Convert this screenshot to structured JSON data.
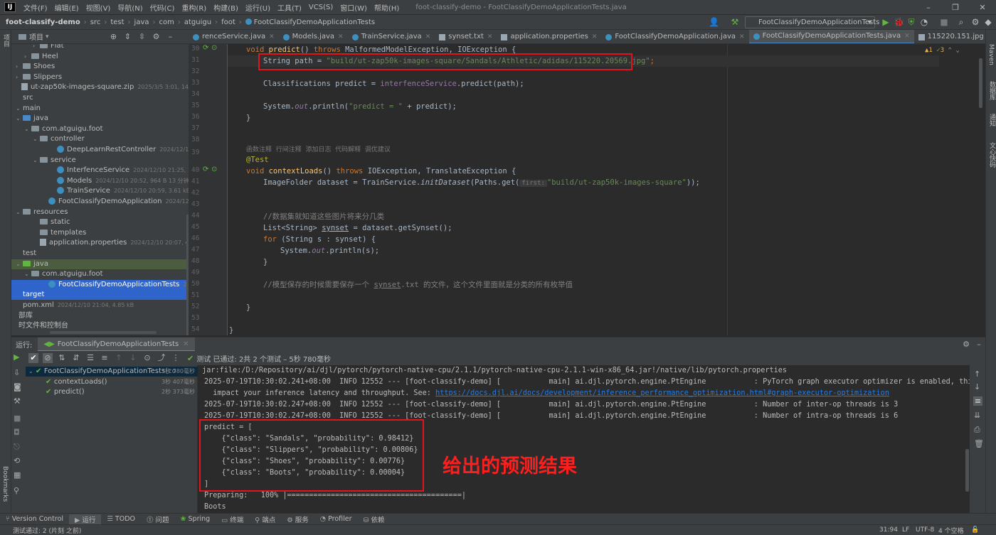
{
  "menu": {
    "items": [
      "文件(F)",
      "编辑(E)",
      "视图(V)",
      "导航(N)",
      "代码(C)",
      "重构(R)",
      "构建(B)",
      "运行(U)",
      "工具(T)",
      "VCS(S)",
      "窗口(W)",
      "帮助(H)"
    ],
    "window_title": "foot-classify-demo - FootClassifyDemoApplicationTests.java"
  },
  "breadcrumb": {
    "project": "foot-classify-demo",
    "parts": [
      "src",
      "test",
      "java",
      "com",
      "atguigu",
      "foot"
    ],
    "file": "FootClassifyDemoApplicationTests"
  },
  "run_config": "FootClassifyDemoApplicationTests",
  "project_panel": {
    "title": "项目",
    "tree": [
      {
        "label": "Flat",
        "meta": "",
        "indent": 30,
        "type": "folder",
        "arrow": "›"
      },
      {
        "label": "Heel",
        "meta": "",
        "indent": 18,
        "type": "folder",
        "arrow": "›"
      },
      {
        "label": "Shoes",
        "meta": "",
        "indent": 6,
        "type": "folder",
        "arrow": "›"
      },
      {
        "label": "Slippers",
        "meta": "",
        "indent": 6,
        "type": "folder",
        "arrow": "›"
      },
      {
        "label": "ut-zap50k-images-square.zip",
        "meta": "2025/3/5 3:01, 144.23 MB",
        "indent": 4,
        "type": "file",
        "arrow": ""
      },
      {
        "label": "src",
        "meta": "",
        "indent": 6,
        "type": "none",
        "arrow": ""
      },
      {
        "label": "main",
        "meta": "",
        "indent": 6,
        "type": "none",
        "arrow": "⌄"
      },
      {
        "label": "java",
        "meta": "",
        "indent": 6,
        "type": "blue",
        "arrow": "⌄"
      },
      {
        "label": "com.atguigu.foot",
        "meta": "",
        "indent": 18,
        "type": "folder",
        "arrow": "⌄"
      },
      {
        "label": "controller",
        "meta": "",
        "indent": 30,
        "type": "folder",
        "arrow": "⌄"
      },
      {
        "label": "DeepLearnRestController",
        "meta": "2024/12/10 21:02,",
        "indent": 54,
        "type": "class",
        "arrow": ""
      },
      {
        "label": "service",
        "meta": "",
        "indent": 30,
        "type": "folder",
        "arrow": "⌄"
      },
      {
        "label": "InterfenceService",
        "meta": "2024/12/10 21:25, 1.88 kB",
        "indent": 54,
        "type": "class",
        "arrow": ""
      },
      {
        "label": "Models",
        "meta": "2024/12/10 20:52, 964 B 13 分钟 之前",
        "indent": 54,
        "type": "class",
        "arrow": ""
      },
      {
        "label": "TrainService",
        "meta": "2024/12/10 20:59, 3.61 kB 22 分钟",
        "indent": 54,
        "type": "class",
        "arrow": ""
      },
      {
        "label": "FootClassifyDemoApplication",
        "meta": "2024/12/10 20:07,",
        "indent": 42,
        "type": "class",
        "arrow": ""
      },
      {
        "label": "resources",
        "meta": "",
        "indent": 6,
        "type": "folder",
        "arrow": "⌄"
      },
      {
        "label": "static",
        "meta": "",
        "indent": 30,
        "type": "folder",
        "arrow": ""
      },
      {
        "label": "templates",
        "meta": "",
        "indent": 30,
        "type": "folder",
        "arrow": ""
      },
      {
        "label": "application.properties",
        "meta": "2024/12/10 20:07, 43 B 26 分",
        "indent": 30,
        "type": "file",
        "arrow": ""
      },
      {
        "label": "test",
        "meta": "",
        "indent": 6,
        "type": "none",
        "arrow": ""
      },
      {
        "label": "java",
        "meta": "",
        "indent": 6,
        "type": "green",
        "arrow": "⌄",
        "selected": "green"
      },
      {
        "label": "com.atguigu.foot",
        "meta": "",
        "indent": 18,
        "type": "folder",
        "arrow": "⌄"
      },
      {
        "label": "FootClassifyDemoApplicationTests",
        "meta": "2025/7/19",
        "indent": 42,
        "type": "class",
        "arrow": "",
        "selected": "blue"
      },
      {
        "label": "target",
        "meta": "",
        "indent": 6,
        "type": "none",
        "arrow": "",
        "selected": "blue"
      },
      {
        "label": "pom.xml",
        "meta": "2024/12/10 21:04, 4.85 kB",
        "indent": 6,
        "type": "none",
        "arrow": ""
      },
      {
        "label": "部库",
        "meta": "",
        "indent": 0,
        "type": "none",
        "arrow": ""
      },
      {
        "label": "时文件和控制台",
        "meta": "",
        "indent": 0,
        "type": "none",
        "arrow": ""
      }
    ]
  },
  "tabs": [
    {
      "label": "renceService.java",
      "kind": "class",
      "active": false
    },
    {
      "label": "Models.java",
      "kind": "class",
      "active": false
    },
    {
      "label": "TrainService.java",
      "kind": "class",
      "active": false
    },
    {
      "label": "synset.txt",
      "kind": "file",
      "active": false
    },
    {
      "label": "application.properties",
      "kind": "file",
      "active": false
    },
    {
      "label": "FootClassifyDemoApplication.java",
      "kind": "class",
      "active": false
    },
    {
      "label": "FootClassifyDemoApplicationTests.java",
      "kind": "class",
      "active": true
    },
    {
      "label": "115220.151.jpg",
      "kind": "file",
      "active": false
    },
    {
      "label": "115220.20569.jpg",
      "kind": "file",
      "active": false
    }
  ],
  "editor": {
    "line_numbers": [
      "30",
      "31",
      "32",
      "33",
      "34",
      "35",
      "36",
      "37",
      "38",
      "39",
      "40",
      "41",
      "42",
      "43",
      "44",
      "45",
      "46",
      "47",
      "48",
      "49",
      "50",
      "51",
      "52",
      "53",
      "54"
    ],
    "inspections": {
      "warnings": "1",
      "weak": "3"
    },
    "code": {
      "l30_kw": "void ",
      "l30_fn": "predict",
      "l30_rest": "() ",
      "l30_kw2": "throws ",
      "l30_rest2": "MalformedModelException, IOException {",
      "l31_a": "String path = ",
      "l31_str": "\"build/ut-zap50k-images-square/Sandals/Athletic/adidas/115220.20569.jpg\"",
      "l31_b": ";",
      "l33_a": "Classifications predict = ",
      "l33_b": "interfenceService",
      ".l33_c": "",
      "l33_c": ".predict(path);",
      "l35_a": "System.",
      "l35_st": "out",
      "l35_b": ".println(",
      "l35_str": "\"predict = \"",
      "l35_c": " + predict);",
      "l36": "}",
      "l38_hint": "函数注释  行间注释  添加日志  代码解释  调优建议",
      "l39": "@Test",
      "l40_kw": "void ",
      "l40_fn": "contextLoads",
      "l40_rest": "() ",
      "l40_kw2": "throws ",
      "l40_rest2": "IOException, TranslateException {",
      "l41_a": "ImageFolder dataset = TrainService.",
      "l41_it": "initDataset",
      "l41_b": "(Paths.get(",
      "l41_hint": "first:",
      "l41_str": "\"build/ut-zap50k-images-square\"",
      "l41_c": "));",
      "l44": "//数据集就知道这些图片将来分几类",
      "l45_a": "List<String> ",
      "l45_u": "synset",
      "l45_b": " = dataset.getSynset();",
      "l46_kw": "for ",
      "l46_b": "(String s : synset) {",
      "l47_a": "System.",
      "l47_st": "out",
      "l47_b": ".println(s);",
      "l48": "}",
      "l50_a": "//模型保存的时候需要保存一个 ",
      "l50_u": "synset",
      "l50_b": ".txt 的文件，这个文件里面就是分类的所有枚举值",
      "l52": "}",
      "l54": "}"
    }
  },
  "run_panel": {
    "label": "运行:",
    "tab": "FootClassifyDemoApplicationTests",
    "status": "测试 已通过: 2共 2 个测试 – 5秒 780毫秒",
    "tree": [
      {
        "label": "FootClassifyDemoApplicationTests",
        "extra": "(co",
        "time": "5秒 780毫秒"
      },
      {
        "label": "contextLoads()",
        "extra": "",
        "time": "3秒 407毫秒"
      },
      {
        "label": "predict()",
        "extra": "",
        "time": "2秒 373毫秒"
      }
    ]
  },
  "console": {
    "lines": [
      " jar:file:/D:/Repository/ai/djl/pytorch/pytorch-native-cpu/2.1.1/pytorch-native-cpu-2.1.1-win-x86_64.jar!/native/lib/pytorch.properties",
      "2025-07-19T10:30:02.241+08:00  INFO 12552 --- [foot-classify-demo] [           main] ai.djl.pytorch.engine.PtEngine           : PyTorch graph executor optimizer is enabled, this may",
      "  impact your inference latency and throughput. See: ",
      "2025-07-19T10:30:02.247+08:00  INFO 12552 --- [foot-classify-demo] [           main] ai.djl.pytorch.engine.PtEngine           : Number of inter-op threads is 3",
      "2025-07-19T10:30:02.247+08:00  INFO 12552 --- [foot-classify-demo] [           main] ai.djl.pytorch.engine.PtEngine           : Number of intra-op threads is 6",
      "predict = [",
      "    {\"class\": \"Sandals\", \"probability\": 0.98412}",
      "    {\"class\": \"Slippers\", \"probability\": 0.00806}",
      "    {\"class\": \"Shoes\", \"probability\": 0.00776}",
      "    {\"class\": \"Boots\", \"probability\": 0.00004}",
      "]",
      "Preparing:   100% |========================================|",
      "Boots"
    ],
    "link": "https://docs.djl.ai/docs/development/inference_performance_optimization.html#graph-executor-optimization"
  },
  "annotation": "给出的预测结果",
  "bottom_tools": [
    "Version Control",
    "运行",
    "TODO",
    "问题",
    "Spring",
    "终端",
    "端点",
    "服务",
    "Profiler",
    "依赖"
  ],
  "status": {
    "left": "测试通过: 2 (片刻 之前)",
    "position": "31:94",
    "line_sep": "LF",
    "encoding": "UTF-8",
    "indent": "4 个空格"
  },
  "left_strip": [
    "项目",
    "Bookmarks",
    "结构"
  ],
  "right_strip": [
    "Maven",
    "数据库",
    "通知",
    "文心快码"
  ],
  "colors": {
    "accent": "#2f65ca",
    "annotation": "#ff1e1e",
    "pass": "#62b543"
  }
}
